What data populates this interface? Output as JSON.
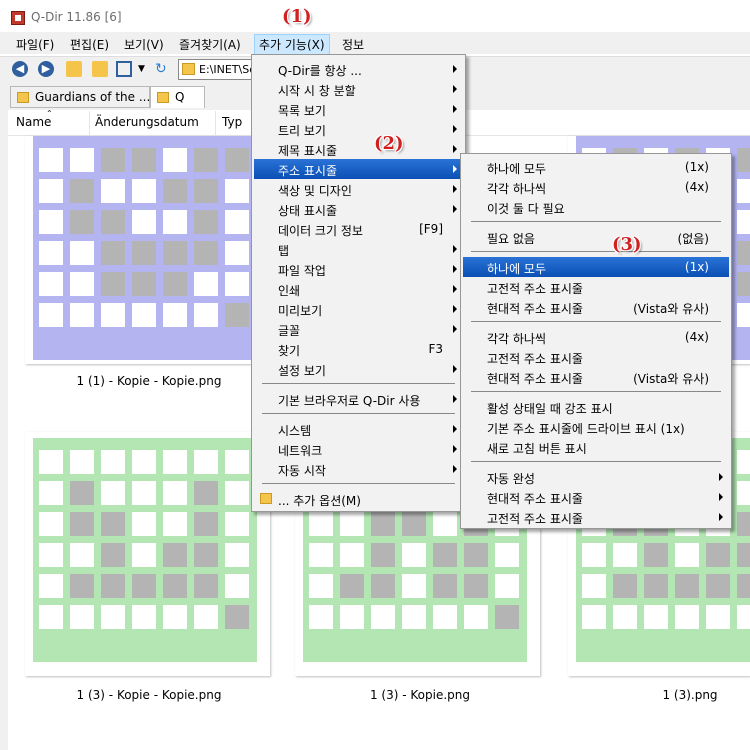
{
  "window": {
    "title": "Q-Dir 11.86 [6]"
  },
  "menubar": {
    "items": [
      "파일(F)",
      "편집(E)",
      "보기(V)",
      "즐겨찾기(A)",
      "추가 기능(X)",
      "정보"
    ]
  },
  "toolbar": {
    "address": "E:\\INET\\Sc"
  },
  "tabs": [
    {
      "label": "Guardians of the ..."
    },
    {
      "label": "Q"
    }
  ],
  "columns": [
    "Name",
    "Änderungsdatum",
    "Typ"
  ],
  "files": {
    "row1": [
      "1 (1) - Kopie - Kopie.png"
    ],
    "row2": [
      "1 (3) - Kopie - Kopie.png",
      "1 (3) - Kopie.png",
      "1 (3).png"
    ]
  },
  "menu_extras": {
    "items": [
      {
        "label": "Q-Dir를 항상 ...",
        "shortcut": ""
      },
      {
        "label": "시작 시 창 분할",
        "shortcut": ""
      },
      {
        "label": "목록 보기",
        "shortcut": ""
      },
      {
        "label": "트리 보기",
        "shortcut": ""
      },
      {
        "label": "제목 표시줄",
        "shortcut": ""
      },
      {
        "label": "주소 표시줄",
        "shortcut": ""
      },
      {
        "label": "색상 및 디자인",
        "shortcut": ""
      },
      {
        "label": "상태 표시줄",
        "shortcut": ""
      },
      {
        "label": "데이터 크기 정보",
        "shortcut": "[F9]"
      },
      {
        "label": "탭",
        "shortcut": ""
      },
      {
        "label": "파일 작업",
        "shortcut": ""
      },
      {
        "label": "인쇄",
        "shortcut": ""
      },
      {
        "label": "미리보기",
        "shortcut": ""
      },
      {
        "label": "글꼴",
        "shortcut": ""
      },
      {
        "label": "찾기",
        "shortcut": "F3"
      },
      {
        "label": "설정 보기",
        "shortcut": ""
      },
      {
        "label": "기본 브라우저로 Q-Dir 사용",
        "shortcut": ""
      },
      {
        "label": "시스템",
        "shortcut": ""
      },
      {
        "label": "네트워크",
        "shortcut": ""
      },
      {
        "label": "자동 시작",
        "shortcut": ""
      },
      {
        "label": "... 추가 옵션(M)",
        "shortcut": ""
      }
    ]
  },
  "menu_address": {
    "items": [
      {
        "label": "하나에 모두",
        "shortcut": "(1x)"
      },
      {
        "label": "각각 하나씩",
        "shortcut": "(4x)"
      },
      {
        "label": "이것 둘 다 필요",
        "shortcut": ""
      },
      {
        "label": "필요 없음",
        "shortcut": "(없음)"
      },
      {
        "label": "하나에 모두",
        "shortcut": "(1x)"
      },
      {
        "label": "고전적 주소 표시줄",
        "shortcut": ""
      },
      {
        "label": "현대적 주소 표시줄",
        "shortcut": "(Vista와 유사)"
      },
      {
        "label": "각각 하나씩",
        "shortcut": "(4x)"
      },
      {
        "label": "고전적 주소 표시줄",
        "shortcut": ""
      },
      {
        "label": "현대적 주소 표시줄",
        "shortcut": "(Vista와 유사)"
      },
      {
        "label": "활성 상태일 때 강조 표시",
        "shortcut": ""
      },
      {
        "label": "기본 주소 표시줄에 드라이브 표시 (1x)",
        "shortcut": ""
      },
      {
        "label": "새로 고침 버튼 표시",
        "shortcut": ""
      },
      {
        "label": "자동 완성",
        "shortcut": ""
      },
      {
        "label": "현대적 주소 표시줄",
        "shortcut": ""
      },
      {
        "label": "고전적 주소 표시줄",
        "shortcut": ""
      }
    ]
  },
  "annotations": [
    "(1)",
    "(2)",
    "(3)"
  ],
  "colors": {
    "highlight": "#0b4fb4",
    "thumb_blue": "#b4b4f0",
    "thumb_green": "#b4e6b4",
    "thumb_gray": "#b4b4b4"
  }
}
